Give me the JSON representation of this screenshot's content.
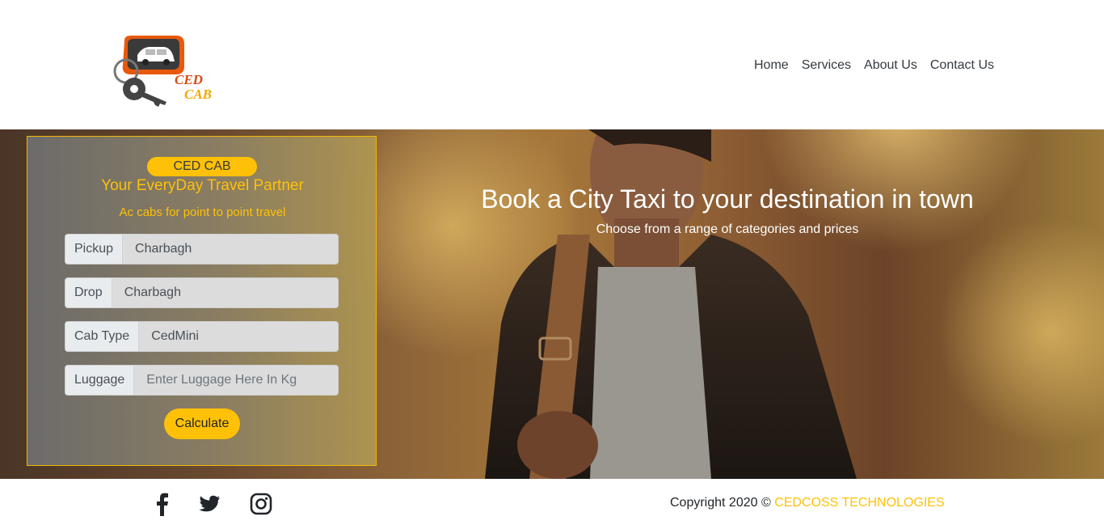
{
  "brand": {
    "logo_line1": "CED",
    "logo_line2": "CAB"
  },
  "nav": {
    "items": [
      "Home",
      "Services",
      "About Us",
      "Contact Us"
    ]
  },
  "hero": {
    "title": "Book a City Taxi to your destination in town",
    "subtitle": "Choose from a range of categories and prices"
  },
  "booking": {
    "badge": "CED CAB",
    "tagline": "Your EveryDay Travel Partner",
    "subline": "Ac cabs for point to point travel",
    "fields": [
      {
        "label": "Pickup",
        "value": "Charbagh"
      },
      {
        "label": "Drop",
        "value": "Charbagh"
      },
      {
        "label": "Cab Type",
        "value": "CedMini"
      },
      {
        "label": "Luggage",
        "placeholder": "Enter Luggage Here In Kg"
      }
    ],
    "calculate_label": "Calculate"
  },
  "footer": {
    "social_icons": [
      "facebook-icon",
      "twitter-icon",
      "instagram-icon"
    ],
    "copyright_prefix": "Copyright 2020 ©",
    "copyright_brand": "CEDCOSS TECHNOLOGIES"
  },
  "colors": {
    "accent": "#ffc107",
    "text_dark": "#212529"
  }
}
